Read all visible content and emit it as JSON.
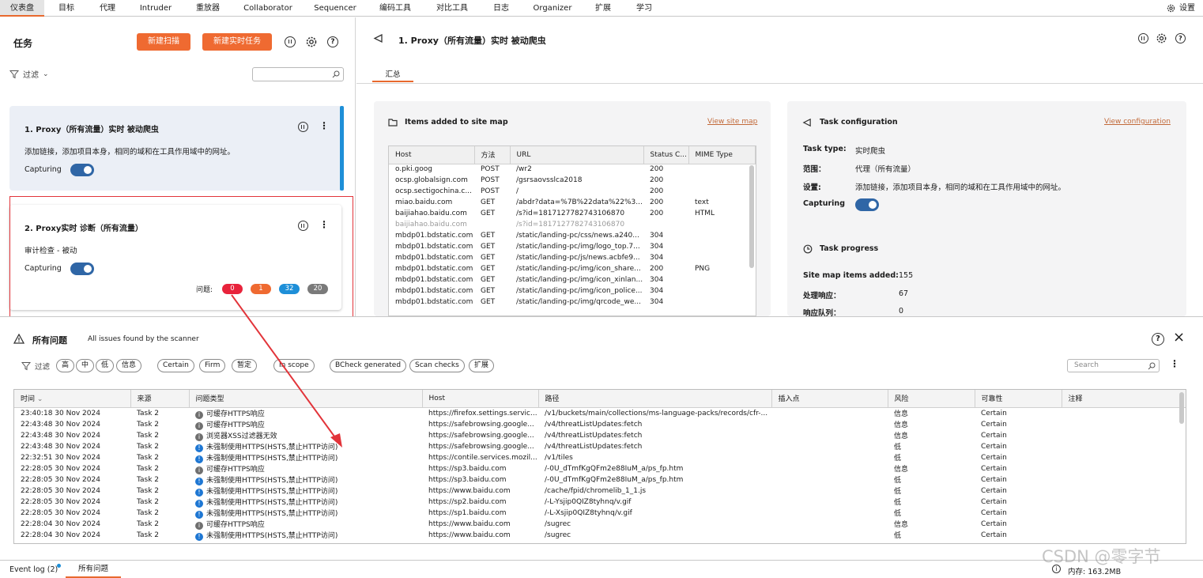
{
  "menu": {
    "tabs": [
      "仪表盘",
      "目标",
      "代理",
      "Intruder",
      "重放器",
      "Collaborator",
      "Sequencer",
      "编码工具",
      "对比工具",
      "日志",
      "Organizer",
      "扩展",
      "学习"
    ],
    "settings": "设置"
  },
  "tasks_panel": {
    "title": "任务",
    "new_scan": "新建扫描",
    "new_live_task": "新建实时任务",
    "filter": "过滤",
    "search_placeholder": ""
  },
  "task_cards": [
    {
      "title": "1. Proxy（所有流量）实时 被动爬虫",
      "desc": "添加链接，添加项目本身，相同的域和在工具作用域中的网址。",
      "capturing": "Capturing"
    },
    {
      "title": "2. Proxy实时 诊断（所有流量）",
      "desc": "审计检查 - 被动",
      "capturing": "Capturing",
      "issues_label": "问题:",
      "counts": [
        "0",
        "1",
        "32",
        "20"
      ]
    }
  ],
  "detail": {
    "title": "1. Proxy（所有流量）实时 被动爬虫",
    "tab": "汇总",
    "sitemap_title": "Items added to site map",
    "view_site_map": "View site map",
    "columns": [
      "Host",
      "方法",
      "URL",
      "Status C...",
      "MIME Type"
    ],
    "rows": [
      [
        "o.pki.goog",
        "POST",
        "/wr2",
        "200",
        ""
      ],
      [
        "ocsp.globalsign.com",
        "POST",
        "/gsrsaovsslca2018",
        "200",
        ""
      ],
      [
        "ocsp.sectigochina.c...",
        "POST",
        "/",
        "200",
        ""
      ],
      [
        "miao.baidu.com",
        "GET",
        "/abdr?data=%7B%22data%22%3...",
        "200",
        "text"
      ],
      [
        "baijiahao.baidu.com",
        "GET",
        "/s?id=1817127782743106870",
        "200",
        "HTML"
      ],
      [
        "baijiahao.baidu.com",
        "",
        "/s?id=1817127782743106870",
        "",
        ""
      ],
      [
        "mbdp01.bdstatic.com",
        "GET",
        "/static/landing-pc/css/news.a240...",
        "304",
        ""
      ],
      [
        "mbdp01.bdstatic.com",
        "GET",
        "/static/landing-pc/img/logo_top.7...",
        "304",
        ""
      ],
      [
        "mbdp01.bdstatic.com",
        "GET",
        "/static/landing-pc/js/news.acbfe9...",
        "304",
        ""
      ],
      [
        "mbdp01.bdstatic.com",
        "GET",
        "/static/landing-pc/img/icon_share...",
        "200",
        "PNG"
      ],
      [
        "mbdp01.bdstatic.com",
        "GET",
        "/static/landing-pc/img/icon_xinlan...",
        "304",
        ""
      ],
      [
        "mbdp01.bdstatic.com",
        "GET",
        "/static/landing-pc/img/icon_police...",
        "304",
        ""
      ],
      [
        "mbdp01.bdstatic.com",
        "GET",
        "/static/landing-pc/img/qrcode_we...",
        "304",
        ""
      ]
    ],
    "config_title": "Task configuration",
    "view_configuration": "View configuration",
    "config": [
      {
        "k": "Task type:",
        "v": "实时爬虫"
      },
      {
        "k": "范围：",
        "v": "代理（所有流量）"
      },
      {
        "k": "设置:",
        "v": "添加链接，添加项目本身，相同的域和在工具作用域中的网址。"
      },
      {
        "k": "Capturing",
        "v": ""
      }
    ],
    "progress_title": "Task progress",
    "progress": [
      {
        "k": "Site map items added:",
        "v": "155"
      },
      {
        "k": "处理响应：",
        "v": "67"
      },
      {
        "k": "响应队列：",
        "v": "0"
      }
    ]
  },
  "issues": {
    "title": "所有问题",
    "subtitle": "All issues found by the scanner",
    "filter": "过滤",
    "chips": [
      "高",
      "中",
      "低",
      "信息",
      "Certain",
      "Firm",
      "暂定",
      "In scope",
      "BCheck generated",
      "Scan checks",
      "扩展"
    ],
    "search_placeholder": "Search",
    "columns": [
      "时间",
      "来源",
      "问题类型",
      "Host",
      "路径",
      "插入点",
      "风险",
      "可靠性",
      "注释"
    ],
    "rows": [
      {
        "time": "23:40:18 30 Nov 2024",
        "src": "Task 2",
        "sev": "info",
        "type": "可缓存HTTPS响应",
        "host": "https://firefox.settings.servic...",
        "path": "/v1/buckets/main/collections/ms-language-packs/records/cfr-...",
        "risk": "信息",
        "conf": "Certain"
      },
      {
        "time": "22:43:48 30 Nov 2024",
        "src": "Task 2",
        "sev": "info",
        "type": "可缓存HTTPS响应",
        "host": "https://safebrowsing.google...",
        "path": "/v4/threatListUpdates:fetch",
        "risk": "信息",
        "conf": "Certain"
      },
      {
        "time": "22:43:48 30 Nov 2024",
        "src": "Task 2",
        "sev": "info",
        "type": "浏览器XSS过滤器无效",
        "host": "https://safebrowsing.google...",
        "path": "/v4/threatListUpdates:fetch",
        "risk": "信息",
        "conf": "Certain"
      },
      {
        "time": "22:43:48 30 Nov 2024",
        "src": "Task 2",
        "sev": "low",
        "type": "未强制使用HTTPS(HSTS,禁止HTTP访问)",
        "host": "https://safebrowsing.google...",
        "path": "/v4/threatListUpdates:fetch",
        "risk": "低",
        "conf": "Certain"
      },
      {
        "time": "22:32:51 30 Nov 2024",
        "src": "Task 2",
        "sev": "low",
        "type": "未强制使用HTTPS(HSTS,禁止HTTP访问)",
        "host": "https://contile.services.mozil...",
        "path": "/v1/tiles",
        "risk": "低",
        "conf": "Certain"
      },
      {
        "time": "22:28:05 30 Nov 2024",
        "src": "Task 2",
        "sev": "info",
        "type": "可缓存HTTPS响应",
        "host": "https://sp3.baidu.com",
        "path": "/-0U_dTmfKgQFm2e88IuM_a/ps_fp.htm",
        "risk": "信息",
        "conf": "Certain"
      },
      {
        "time": "22:28:05 30 Nov 2024",
        "src": "Task 2",
        "sev": "low",
        "type": "未强制使用HTTPS(HSTS,禁止HTTP访问)",
        "host": "https://sp3.baidu.com",
        "path": "/-0U_dTmfKgQFm2e88IuM_a/ps_fp.htm",
        "risk": "低",
        "conf": "Certain"
      },
      {
        "time": "22:28:05 30 Nov 2024",
        "src": "Task 2",
        "sev": "low",
        "type": "未强制使用HTTPS(HSTS,禁止HTTP访问)",
        "host": "https://www.baidu.com",
        "path": "/cache/fpid/chromelib_1_1.js",
        "risk": "低",
        "conf": "Certain"
      },
      {
        "time": "22:28:05 30 Nov 2024",
        "src": "Task 2",
        "sev": "low",
        "type": "未强制使用HTTPS(HSTS,禁止HTTP访问)",
        "host": "https://sp2.baidu.com",
        "path": "/-L-Ysjip0QIZ8tyhnq/v.gif",
        "risk": "低",
        "conf": "Certain"
      },
      {
        "time": "22:28:05 30 Nov 2024",
        "src": "Task 2",
        "sev": "low",
        "type": "未强制使用HTTPS(HSTS,禁止HTTP访问)",
        "host": "https://sp1.baidu.com",
        "path": "/-L-Xsjip0QIZ8tyhnq/v.gif",
        "risk": "低",
        "conf": "Certain"
      },
      {
        "time": "22:28:04 30 Nov 2024",
        "src": "Task 2",
        "sev": "info",
        "type": "可缓存HTTPS响应",
        "host": "https://www.baidu.com",
        "path": "/sugrec",
        "risk": "信息",
        "conf": "Certain"
      },
      {
        "time": "22:28:04 30 Nov 2024",
        "src": "Task 2",
        "sev": "low",
        "type": "未强制使用HTTPS(HSTS,禁止HTTP访问)",
        "host": "https://www.baidu.com",
        "path": "/sugrec",
        "risk": "低",
        "conf": "Certain"
      }
    ]
  },
  "status": {
    "event_log": "Event log (2)",
    "all_issues": "所有问题",
    "memory": "内存: 163.2MB",
    "watermark": "CSDN @零字节"
  },
  "colors": {
    "accent": "#ef6a31",
    "toggle": "#2f66a6",
    "high": "#e8233b",
    "medium": "#ef6a31",
    "low": "#1e8fd8",
    "info": "#7a7a7a",
    "highlight_box": "#e2343a"
  }
}
